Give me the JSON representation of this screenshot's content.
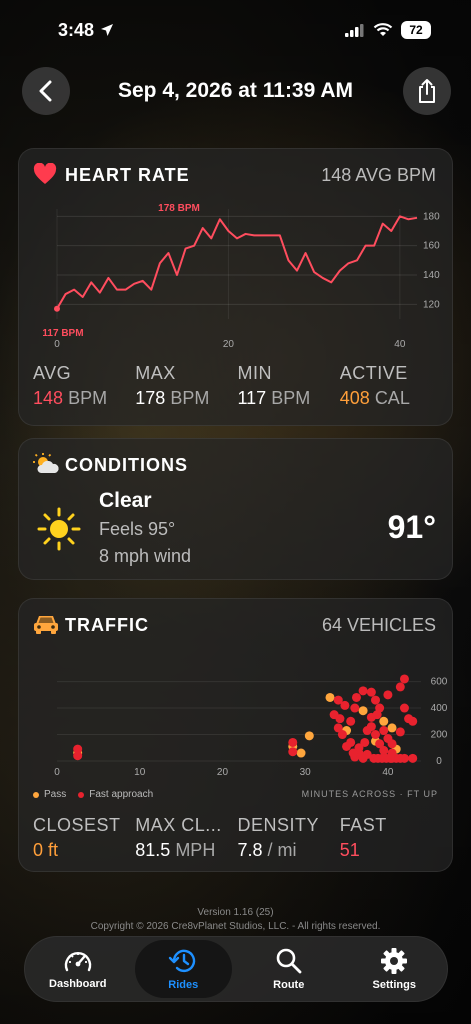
{
  "status_bar": {
    "time": "3:48",
    "battery": "72"
  },
  "header": {
    "title": "Sep 4, 2026 at 11:39 AM"
  },
  "heart_rate": {
    "title": "HEART RATE",
    "summary": "148 AVG BPM",
    "max_badge": "178 BPM",
    "min_badge": "117 BPM",
    "stats": [
      {
        "label": "AVG",
        "value": "148",
        "unit": "BPM"
      },
      {
        "label": "MAX",
        "value": "178",
        "unit": "BPM"
      },
      {
        "label": "MIN",
        "value": "117",
        "unit": "BPM"
      },
      {
        "label": "ACTIVE",
        "value": "408",
        "unit": "CAL"
      }
    ],
    "colors": {
      "line": "#ff4d5e",
      "accent_orange": "#ff9f3a"
    }
  },
  "conditions": {
    "title": "CONDITIONS",
    "condition": "Clear",
    "feels": "Feels 95°",
    "wind": "8 mph wind",
    "temperature": "91°"
  },
  "traffic": {
    "title": "TRAFFIC",
    "summary": "64 VEHICLES",
    "legend": {
      "pass": "Pass",
      "fast": "Fast approach",
      "note": "MINUTES ACROSS · FT UP"
    },
    "stats": [
      {
        "label": "CLOSEST",
        "value": "0 ft",
        "unit": ""
      },
      {
        "label": "MAX CL...",
        "value": "81.5",
        "unit": "MPH"
      },
      {
        "label": "DENSITY",
        "value": "7.8",
        "unit": "/ mi"
      },
      {
        "label": "FAST",
        "value": "51",
        "unit": ""
      }
    ],
    "colors": {
      "pass": "#ffa63d",
      "fast": "#e8222e"
    }
  },
  "footer": {
    "version": "Version 1.16 (25)",
    "copyright": "Copyright © 2026 Cre8vPlanet Studios, LLC. - All rights reserved."
  },
  "tabs": [
    {
      "label": "Dashboard",
      "icon": "speedometer-icon"
    },
    {
      "label": "Rides",
      "icon": "history-icon"
    },
    {
      "label": "Route",
      "icon": "search-icon"
    },
    {
      "label": "Settings",
      "icon": "gear-icon"
    }
  ],
  "chart_data": [
    {
      "type": "line",
      "title": "HEART RATE",
      "x": [
        0,
        1,
        2,
        3,
        4,
        5,
        6,
        7,
        8,
        9,
        10,
        11,
        12,
        13,
        14,
        15,
        16,
        17,
        18,
        19,
        20,
        21,
        22,
        23,
        24,
        25,
        26,
        27,
        28,
        29,
        30,
        31,
        32,
        33,
        34,
        35,
        36,
        37,
        38,
        39,
        40,
        41,
        42
      ],
      "series": [
        {
          "values": [
            117,
            127,
            130,
            125,
            135,
            128,
            138,
            130,
            130,
            134,
            136,
            130,
            148,
            155,
            140,
            158,
            160,
            172,
            165,
            178,
            170,
            165,
            168,
            167,
            167,
            167,
            167,
            150,
            143,
            155,
            142,
            138,
            135,
            143,
            148,
            150,
            160,
            160,
            175,
            170,
            180,
            178,
            179
          ]
        }
      ],
      "xticks": [
        0,
        20,
        40
      ],
      "yticks": [
        120,
        140,
        160,
        180
      ],
      "xlim": [
        0,
        42
      ],
      "ylim": [
        110,
        185
      ]
    },
    {
      "type": "scatter",
      "title": "TRAFFIC",
      "xticks": [
        0,
        10,
        20,
        30,
        40
      ],
      "yticks": [
        0,
        200,
        400,
        600
      ],
      "xlim": [
        0,
        44
      ],
      "ylim": [
        0,
        680
      ],
      "series": [
        {
          "name": "Pass",
          "points": [
            [
              2.5,
              60
            ],
            [
              28.5,
              110
            ],
            [
              29.5,
              60
            ],
            [
              33,
              480
            ],
            [
              37,
              380
            ],
            [
              38.5,
              150
            ],
            [
              40.5,
              250
            ],
            [
              41,
              90
            ],
            [
              35,
              230
            ],
            [
              39.5,
              300
            ],
            [
              30.5,
              190
            ]
          ]
        },
        {
          "name": "Fast approach",
          "points": [
            [
              2.5,
              90
            ],
            [
              2.5,
              40
            ],
            [
              28.5,
              140
            ],
            [
              28.5,
              70
            ],
            [
              34,
              460
            ],
            [
              35.5,
              300
            ],
            [
              36,
              400
            ],
            [
              37,
              530
            ],
            [
              38,
              520
            ],
            [
              38.5,
              460
            ],
            [
              39,
              400
            ],
            [
              38,
              330
            ],
            [
              40,
              500
            ],
            [
              41.5,
              220
            ],
            [
              41.5,
              560
            ],
            [
              42,
              400
            ],
            [
              42,
              620
            ],
            [
              43,
              300
            ],
            [
              34,
              250
            ],
            [
              34.5,
              200
            ],
            [
              35,
              110
            ],
            [
              35.5,
              140
            ],
            [
              36,
              30
            ],
            [
              36.5,
              100
            ],
            [
              37.5,
              50
            ],
            [
              37.5,
              230
            ],
            [
              38,
              260
            ],
            [
              38.5,
              200
            ],
            [
              39,
              130
            ],
            [
              39.5,
              80
            ],
            [
              40,
              170
            ],
            [
              40.5,
              20
            ],
            [
              41,
              20
            ],
            [
              41.5,
              20
            ],
            [
              42,
              20
            ],
            [
              43,
              20
            ],
            [
              40.5,
              130
            ],
            [
              38.3,
              20
            ],
            [
              38.8,
              20
            ],
            [
              39.3,
              20
            ],
            [
              39.8,
              20
            ],
            [
              40.3,
              20
            ],
            [
              37,
              20
            ],
            [
              36.5,
              60
            ],
            [
              35.8,
              60
            ],
            [
              37.2,
              140
            ],
            [
              39.5,
              230
            ],
            [
              40.5,
              60
            ],
            [
              33.5,
              350
            ],
            [
              34.2,
              320
            ],
            [
              34.8,
              420
            ],
            [
              36.2,
              480
            ],
            [
              38.7,
              350
            ],
            [
              42.5,
              320
            ]
          ]
        }
      ]
    }
  ]
}
